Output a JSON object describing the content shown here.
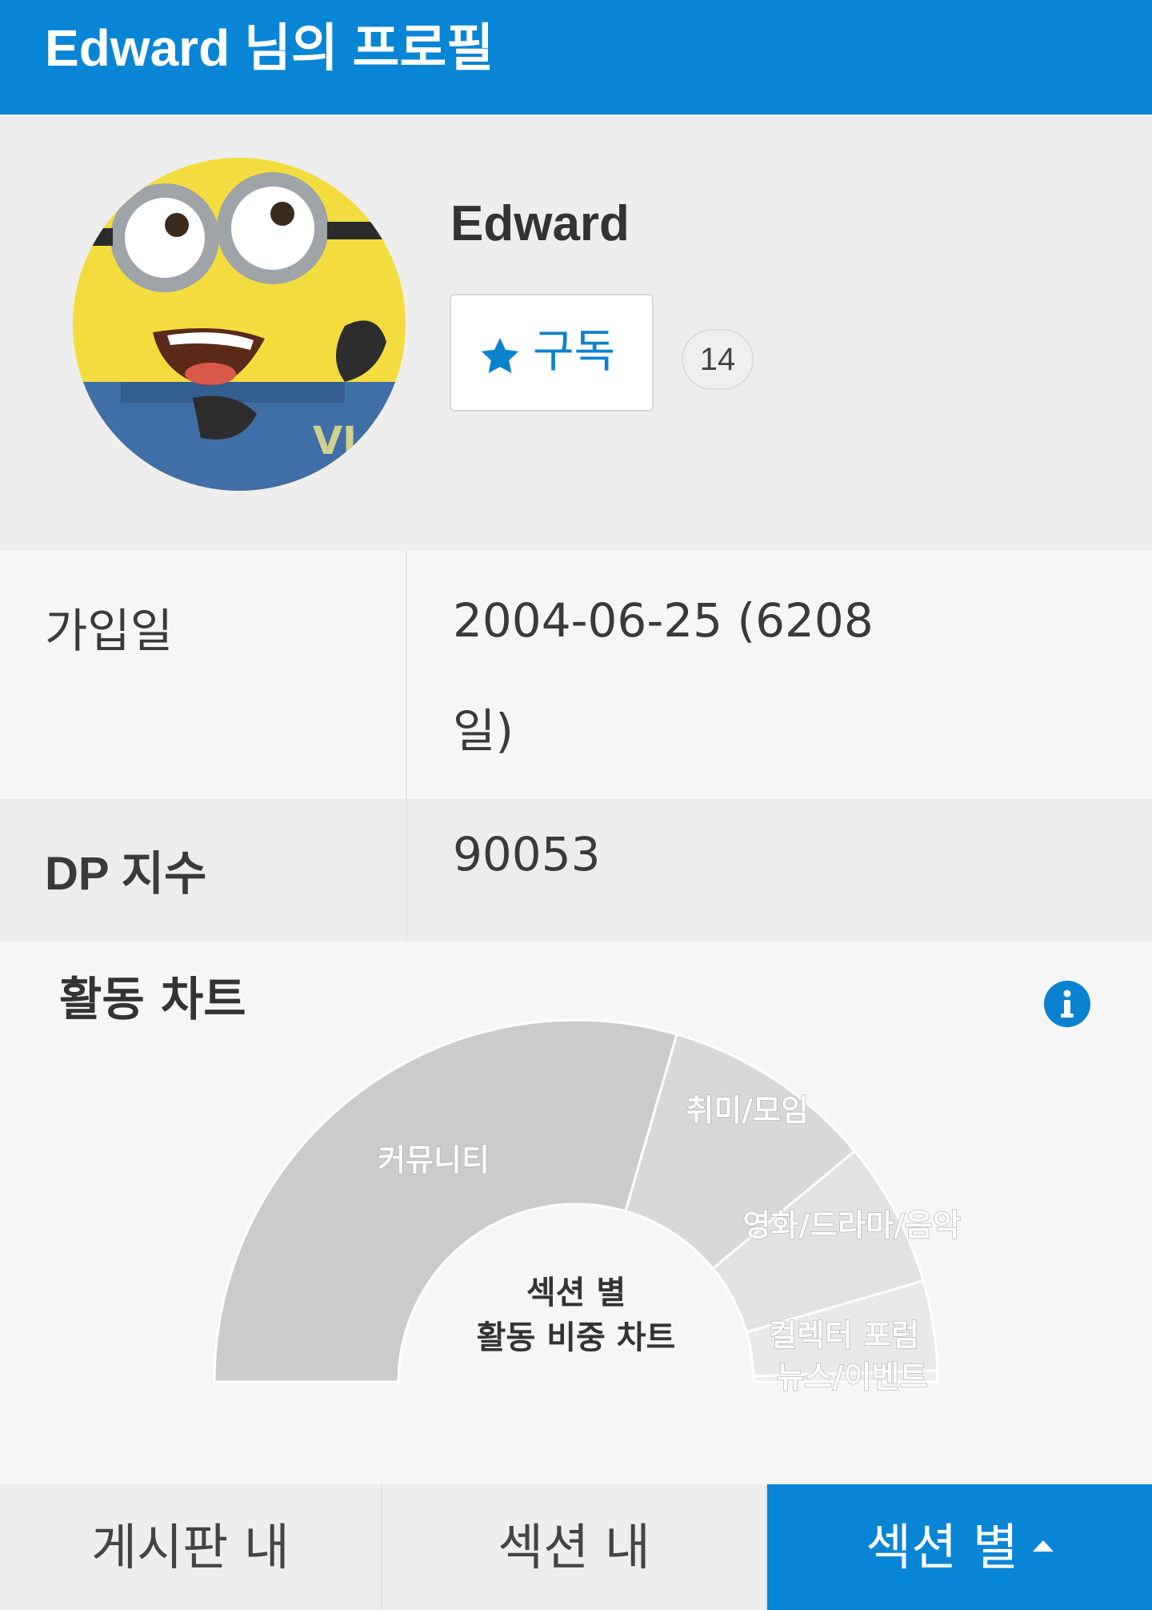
{
  "header": {
    "title": "Edward 님의 프로필"
  },
  "profile": {
    "username": "Edward",
    "subscribe_label": "구독",
    "subscriber_count": "14",
    "avatar_icon": "minion-avatar"
  },
  "info_rows": {
    "join": {
      "label": "가입일",
      "value_line1": "2004-06-25 (6208",
      "value_line2": "일)"
    },
    "dp": {
      "label": "DP 지수",
      "value": "90053"
    }
  },
  "activity_chart": {
    "title": "활동 차트",
    "center_line1": "섹션 별",
    "center_line2": "활동 비중 차트",
    "info_icon": "info-icon"
  },
  "chart_data": {
    "type": "pie",
    "variant": "half-donut",
    "labels": [
      "커뮤니티",
      "취미/모임",
      "영화/드라마/음악",
      "컬렉터 포럼",
      "뉴스/이벤트"
    ],
    "values": [
      59,
      19,
      13,
      8,
      1
    ],
    "colors": [
      "#cbcbcb",
      "#d8d8d8",
      "#e2e2e2",
      "#e9e9e9",
      "#eeeeee"
    ]
  },
  "tabs": {
    "board": "게시판 내",
    "section": "섹션 내",
    "by_section": "섹션 별"
  },
  "colors": {
    "brand": "#0985d6",
    "accent_text": "#0b82d0"
  }
}
